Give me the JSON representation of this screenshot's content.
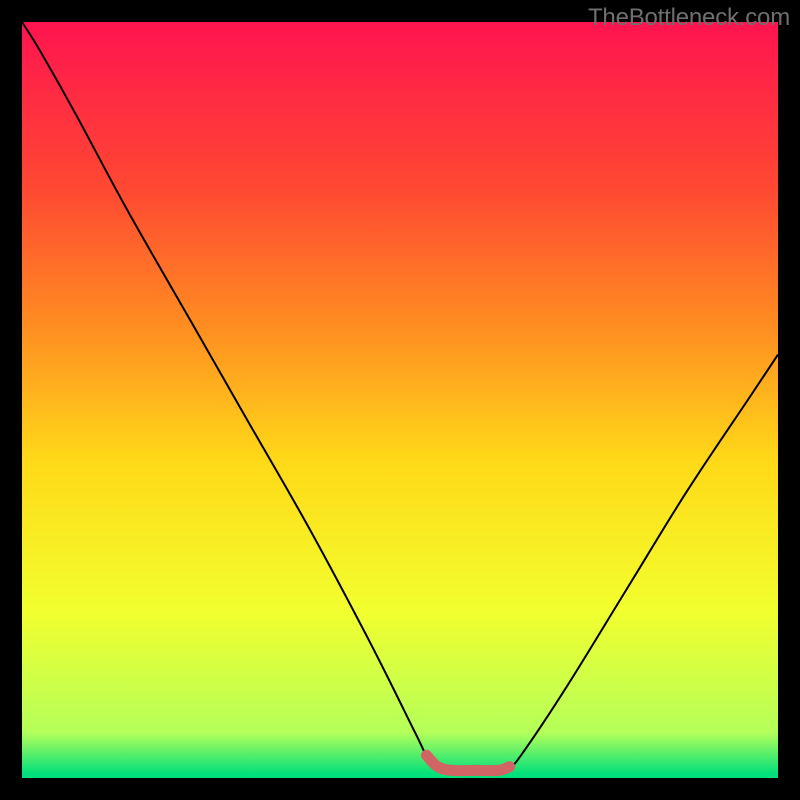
{
  "watermark": "TheBottleneck.com",
  "chart_data": {
    "type": "line",
    "title": "",
    "xlabel": "",
    "ylabel": "",
    "x_range": [
      0,
      100
    ],
    "y_range": [
      0,
      100
    ],
    "grid": false,
    "legend": false,
    "background_gradient": {
      "direction": "vertical",
      "stops": [
        {
          "pos": 0.0,
          "color": "#ff1450"
        },
        {
          "pos": 0.22,
          "color": "#ff4832"
        },
        {
          "pos": 0.4,
          "color": "#ff8c21"
        },
        {
          "pos": 0.58,
          "color": "#ffd918"
        },
        {
          "pos": 0.78,
          "color": "#f2ff2e"
        },
        {
          "pos": 0.94,
          "color": "#b4ff5a"
        },
        {
          "pos": 0.995,
          "color": "#00e07b"
        }
      ]
    },
    "series": [
      {
        "name": "bottleneck-curve",
        "stroke": "#000000",
        "stroke_width": 2,
        "x": [
          0.0,
          2.5,
          7.0,
          14.0,
          22.0,
          30.0,
          38.0,
          46.0,
          52.0,
          53.5,
          55.0,
          57.0,
          60.0,
          63.0,
          64.5,
          66.0,
          72.0,
          80.0,
          88.0,
          96.0,
          100.0
        ],
        "y": [
          100.0,
          96.0,
          88.0,
          75.0,
          61.0,
          47.0,
          33.0,
          18.0,
          6.0,
          3.0,
          1.5,
          1.0,
          1.0,
          1.0,
          1.5,
          3.0,
          12.0,
          25.0,
          38.0,
          50.0,
          56.0
        ]
      },
      {
        "name": "optimal-flat-highlight",
        "stroke": "#d16464",
        "stroke_width": 11,
        "linecap": "round",
        "x": [
          53.5,
          55.0,
          57.0,
          60.0,
          63.0,
          64.5
        ],
        "y": [
          3.0,
          1.5,
          1.0,
          1.0,
          1.0,
          1.5
        ]
      }
    ]
  }
}
